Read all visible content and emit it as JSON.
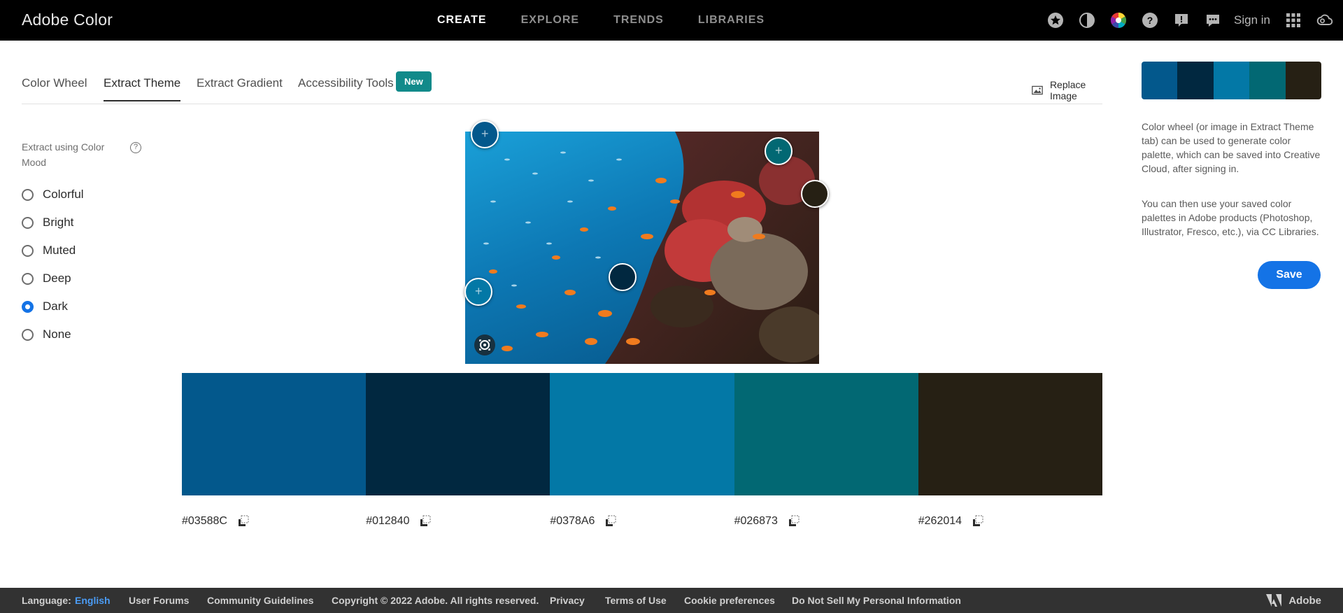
{
  "header": {
    "brand": "Adobe Color",
    "nav": [
      "CREATE",
      "EXPLORE",
      "TRENDS",
      "LIBRARIES"
    ],
    "active_nav": "CREATE",
    "sign_in": "Sign in",
    "icons": [
      "favorites-icon",
      "contrast-icon",
      "color-wheel-icon",
      "help-icon",
      "feedback-icon",
      "chat-icon",
      "apps-grid-icon",
      "creative-cloud-icon"
    ]
  },
  "tabs": {
    "items": [
      "Color Wheel",
      "Extract Theme",
      "Extract Gradient",
      "Accessibility Tools"
    ],
    "active": "Extract Theme",
    "new_badge": "New",
    "replace_image": "Replace Image"
  },
  "mood": {
    "label": "Extract using Color Mood",
    "help": "?",
    "options": [
      "Colorful",
      "Bright",
      "Muted",
      "Deep",
      "Dark",
      "None"
    ],
    "selected": "Dark"
  },
  "theme": {
    "colors": [
      "#03588C",
      "#012840",
      "#0378A6",
      "#026873",
      "#262014"
    ],
    "hex_labels": [
      "#03588C",
      "#012840",
      "#0378A6",
      "#026873",
      "#262014"
    ]
  },
  "sidebar": {
    "info1": "Color wheel (or image in Extract Theme tab) can be used to generate color palette, which can be saved into Creative Cloud, after signing in.",
    "info2": "You can then use your saved color palettes in Adobe products (Photoshop, Illustrator, Fresco, etc.), via CC Libraries.",
    "save": "Save"
  },
  "footer": {
    "language_label": "Language:",
    "language": "English",
    "links": [
      "User Forums",
      "Community Guidelines",
      "Copyright © 2022 Adobe. All rights reserved.",
      "Privacy",
      "Terms of Use",
      "Cookie preferences",
      "Do Not Sell My Personal Information"
    ],
    "adobe": "Adobe"
  }
}
